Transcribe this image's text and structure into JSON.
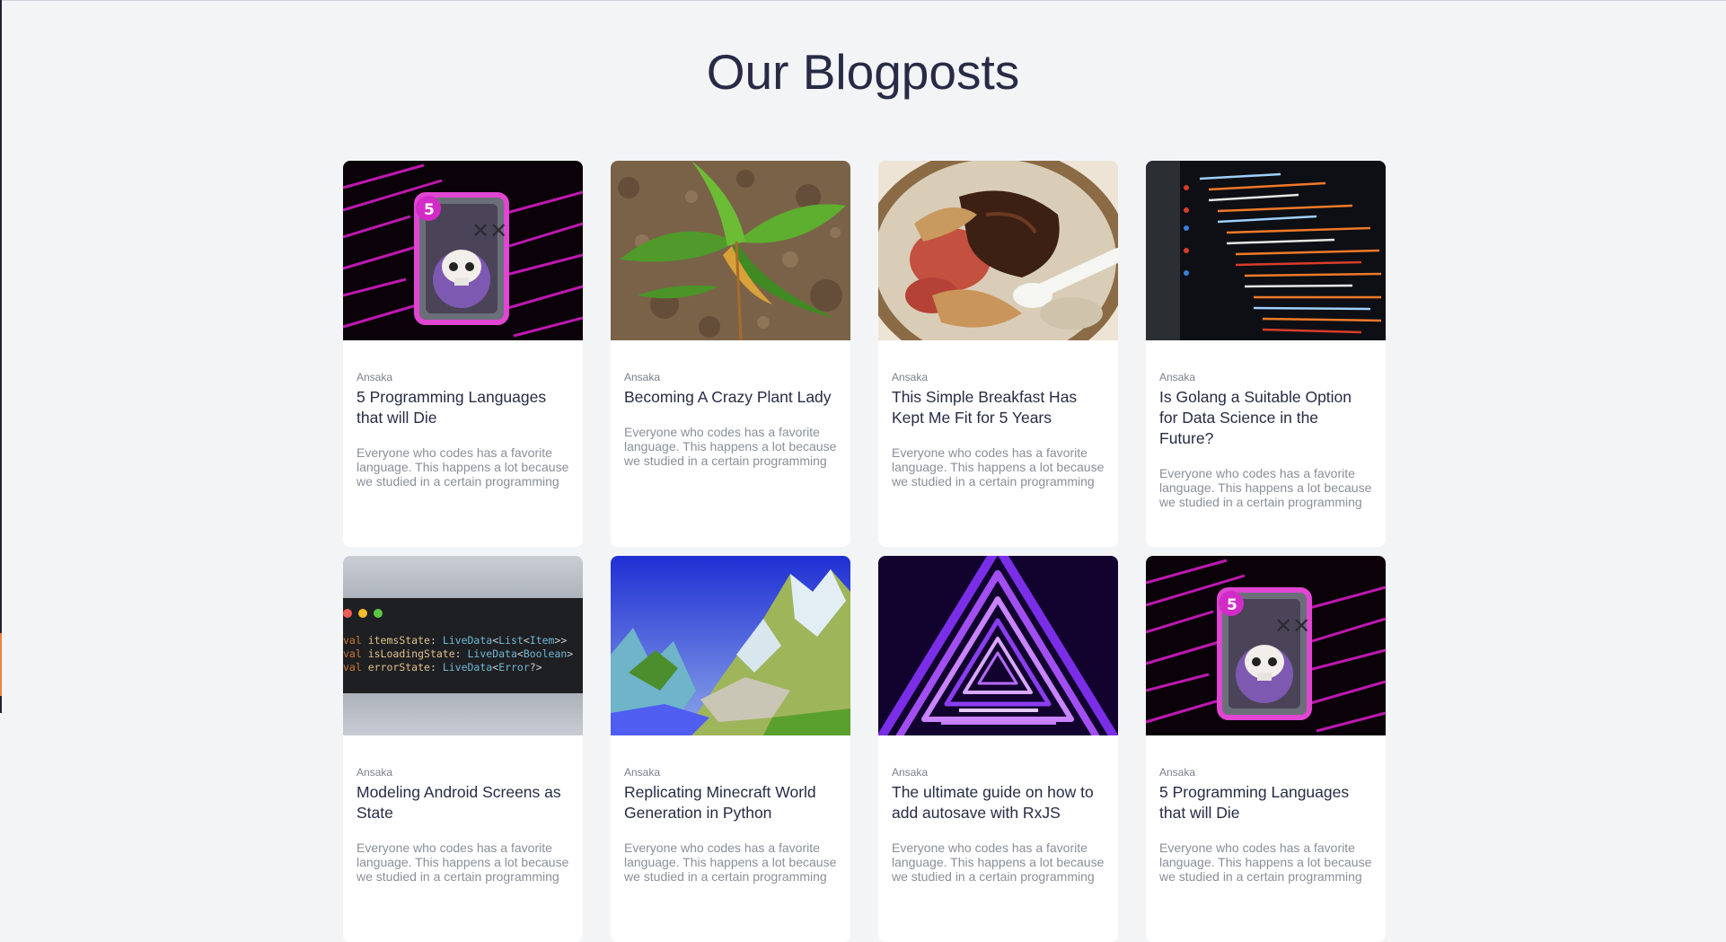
{
  "page": {
    "heading": "Our Blogposts"
  },
  "posts": [
    {
      "author": "Ansaka",
      "title": "5 Programming Languages that will Die",
      "excerpt": "Everyone who codes has a favorite language. This happens a lot because we studied in a certain programming",
      "image_icon": "skull-card-icon"
    },
    {
      "author": "Ansaka",
      "title": "Becoming A Crazy Plant Lady",
      "excerpt": "Everyone who codes has a favorite language. This happens a lot because we studied in a certain programming",
      "image_icon": "plant-photo"
    },
    {
      "author": "Ansaka",
      "title": "This Simple Breakfast Has Kept Me Fit for 5 Years",
      "excerpt": "Everyone who codes has a favorite language. This happens a lot because we studied in a certain programming",
      "image_icon": "oatmeal-photo"
    },
    {
      "author": "Ansaka",
      "title": "Is Golang a Suitable Option for Data Science in the Future?",
      "excerpt": "Everyone who codes has a favorite language. This happens a lot because we studied in a certain programming",
      "image_icon": "code-monitor-photo"
    },
    {
      "author": "Ansaka",
      "title": "Modeling Android Screens as State",
      "excerpt": "Everyone who codes has a favorite language. This happens a lot because we studied in a certain programming",
      "image_icon": "code-window-icon",
      "code_lines": [
        [
          "val ",
          "itemsState",
          ": ",
          "LiveData",
          "<",
          "List",
          "<",
          "Item",
          ">>"
        ],
        [
          "val ",
          "isLoadingState",
          ": ",
          "LiveData",
          "<",
          "Boolean",
          ">"
        ],
        [
          "val ",
          "errorState",
          ": ",
          "LiveData",
          "<",
          "Error",
          "?>"
        ]
      ]
    },
    {
      "author": "Ansaka",
      "title": "Replicating Minecraft World Generation in Python",
      "excerpt": "Everyone who codes has a favorite language. This happens a lot because we studied in a certain programming",
      "image_icon": "voxel-landscape-image"
    },
    {
      "author": "Ansaka",
      "title": "The ultimate guide on how to add autosave with RxJS",
      "excerpt": "Everyone who codes has a favorite language. This happens a lot because we studied in a certain programming",
      "image_icon": "neon-triangle-tunnel-image"
    },
    {
      "author": "Ansaka",
      "title": "5 Programming Languages that will Die",
      "excerpt": "Everyone who codes has a favorite language. This happens a lot because we studied in a certain programming",
      "image_icon": "skull-card-icon"
    }
  ],
  "colors": {
    "background": "#f3f4f6",
    "heading": "#272b45",
    "card": "#ffffff",
    "muted": "#8a8e99"
  }
}
